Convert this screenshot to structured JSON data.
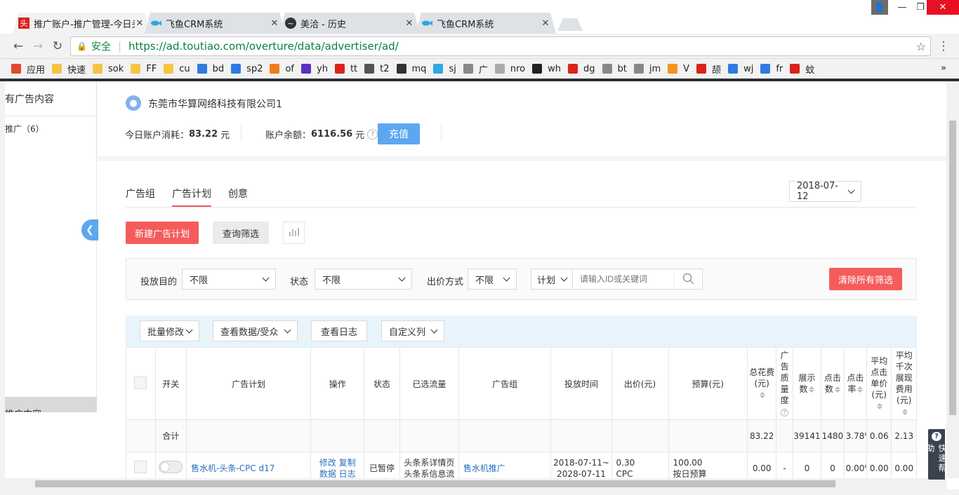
{
  "browser": {
    "tabs": [
      {
        "title": "推广账户-推广管理-今日头",
        "favicon": "toutiao-icon",
        "fav_text": "头",
        "fav_color": "#d9241a"
      },
      {
        "title": "飞鱼CRM系统",
        "favicon": "fish-icon",
        "fav_color": "#2fa7e0"
      },
      {
        "title": "美洽 - 历史",
        "favicon": "chat-icon",
        "fav_color": "#333333"
      },
      {
        "title": "飞鱼CRM系统",
        "favicon": "fish-icon",
        "fav_color": "#2fa7e0"
      }
    ],
    "security_label": "安全",
    "url": "https://ad.toutiao.com/overture/data/advertiser/ad/",
    "bookmarks": [
      "应用",
      "快速",
      "sok",
      "FF",
      "cu",
      "bd",
      "sp2",
      "of",
      "yh",
      "tt",
      "t2",
      "mq",
      "sj",
      "广",
      "nro",
      "wh",
      "dg",
      "bt",
      "jm",
      "V",
      "颉",
      "wj",
      "fr",
      "蚊"
    ]
  },
  "sidebar": {
    "header": "有广告内容",
    "item": "推广（6）",
    "bottom": "推广内容"
  },
  "account": {
    "name": "东莞市华算网络科技有限公司1",
    "today_label": "今日账户消耗：",
    "today_value": "83.22",
    "unit": "元",
    "balance_label": "账户余额：",
    "balance_value": "6116.56",
    "recharge": "充值"
  },
  "tabs": [
    "广告组",
    "广告计划",
    "创意"
  ],
  "date": "2018-07-12",
  "actions": {
    "new_plan": "新建广告计划",
    "query_filter": "查询筛选"
  },
  "filters": {
    "goal_label": "投放目的",
    "goal_value": "不限",
    "status_label": "状态",
    "status_value": "不限",
    "bid_label": "出价方式",
    "bid_value": "不限",
    "plan_select": "计划",
    "search_placeholder": "请输入ID或关键词",
    "clear": "清除所有筛选"
  },
  "toolbar": {
    "batch": "批量修改",
    "view_data": "查看数据/受众",
    "log": "查看日志",
    "custom": "自定义列"
  },
  "table": {
    "headers": [
      "开关",
      "广告计划",
      "操作",
      "状态",
      "已选流量",
      "广告组",
      "投放时间",
      "出价(元)",
      "预算(元)"
    ],
    "metric_headers": [
      "总花费(元)",
      "广告质量度",
      "展示数",
      "点击数",
      "点击率",
      "平均点击单价(元)",
      "平均千次展现费用(元)"
    ],
    "total": {
      "label": "合计",
      "cost": "83.22",
      "quality": "",
      "shows": "39141",
      "clicks": "1480",
      "ctr": "3.78%",
      "cpc": "0.06",
      "cpm": "2.13"
    },
    "rows": [
      {
        "plan": "售水机-头条-CPC d17",
        "ops1": "修改 复制",
        "ops2": "数据 日志",
        "status": "已暂停",
        "flow1": "头条系详情页",
        "flow2": "头条系信息流",
        "group": "售水机推广",
        "time1": "2018-07-11~",
        "time2": "2028-07-11",
        "bid1": "0.30",
        "bid2": "CPC",
        "budget1": "100.00",
        "budget2": "按日预算",
        "cost": "0.00",
        "quality": "-",
        "shows": "0",
        "clicks": "0",
        "ctr": "0.00%",
        "cpc": "0.00",
        "cpm": "0.00"
      }
    ]
  },
  "help": {
    "label": "快速帮助"
  },
  "colors": {
    "primary_red": "#f45c5c",
    "link_blue": "#2a6fbd",
    "recharge_blue": "#5da6f0",
    "toolbar_bg": "#e8f4fb"
  }
}
